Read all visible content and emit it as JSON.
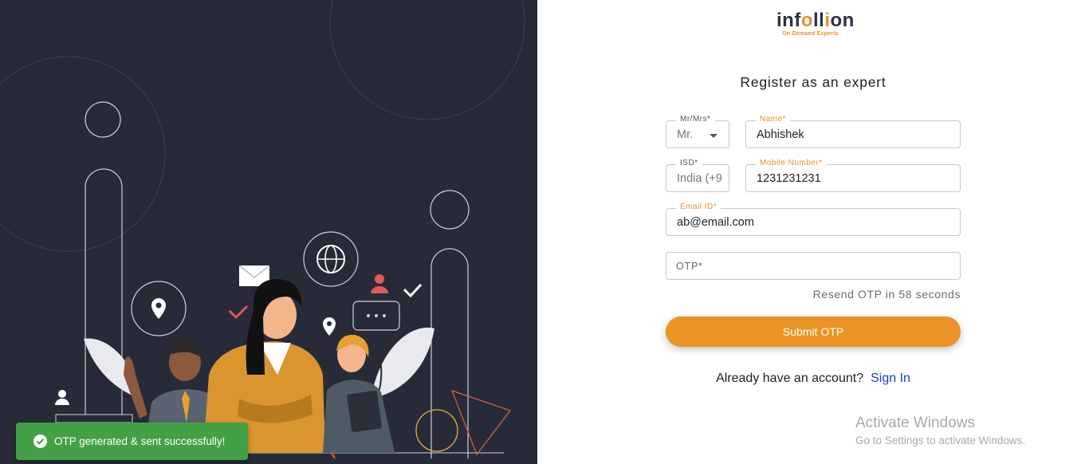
{
  "toast": {
    "message": "OTP generated & sent successfully!",
    "color": "#43a047",
    "icon": "check-circle-icon"
  },
  "logo": {
    "name_pre": "inf",
    "name_o": "o",
    "name_mid": "ll",
    "name_i": "i",
    "name_end": "on",
    "tagline": "On-Demand Experts"
  },
  "form": {
    "title": "Register as an expert",
    "salutation": {
      "label": "Mr/Mrs*",
      "value": "Mr."
    },
    "name": {
      "label": "Name*",
      "value": "Abhishek"
    },
    "isd": {
      "label": "ISD*",
      "value": "India (+9"
    },
    "mobile": {
      "label": "Mobile Number*",
      "value": "1231231231"
    },
    "email": {
      "label": "Email ID*",
      "value": "ab@email.com"
    },
    "otp": {
      "placeholder": "OTP*"
    },
    "resend_text": "Resend OTP in 58 seconds",
    "submit_label": "Submit OTP",
    "account_prompt": "Already have an account?",
    "signin_label": "Sign In"
  },
  "watermark": {
    "line1": "Activate Windows",
    "line2": "Go to Settings to activate Windows."
  },
  "colors": {
    "panel_bg": "#272b38",
    "accent": "#e99424",
    "link": "#1a3fcf"
  }
}
